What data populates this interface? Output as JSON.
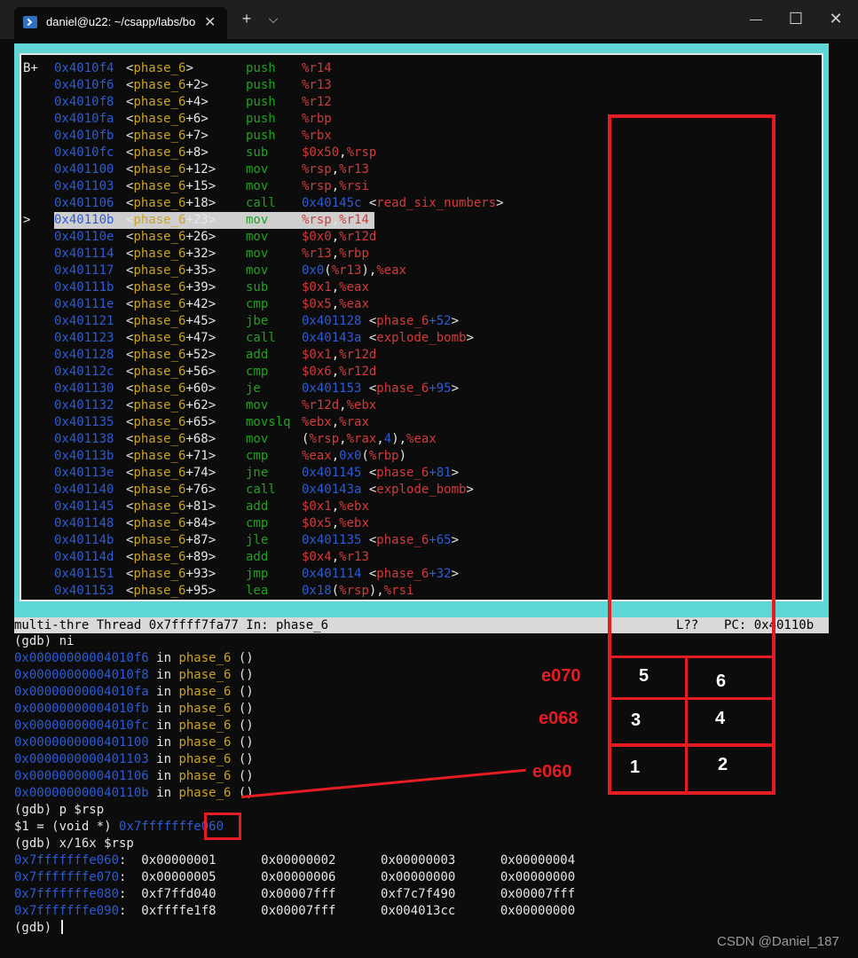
{
  "window": {
    "tab_title": "daniel@u22: ~/csapp/labs/bo",
    "tab_close": "✕",
    "new_tab": "+",
    "dropdown": "⌵",
    "minimize": "—",
    "maximize": "☐",
    "close": "✕"
  },
  "asm": [
    {
      "mark": "B+",
      "addr": "0x4010f4",
      "sym": [
        "phase_6",
        ""
      ],
      "op": "push",
      "args": [
        [
          "reg",
          "%r14"
        ]
      ]
    },
    {
      "mark": "",
      "addr": "0x4010f6",
      "sym": [
        "phase_6",
        "+2"
      ],
      "op": "push",
      "args": [
        [
          "reg",
          "%r13"
        ]
      ]
    },
    {
      "mark": "",
      "addr": "0x4010f8",
      "sym": [
        "phase_6",
        "+4"
      ],
      "op": "push",
      "args": [
        [
          "reg",
          "%r12"
        ]
      ]
    },
    {
      "mark": "",
      "addr": "0x4010fa",
      "sym": [
        "phase_6",
        "+6"
      ],
      "op": "push",
      "args": [
        [
          "reg",
          "%rbp"
        ]
      ]
    },
    {
      "mark": "",
      "addr": "0x4010fb",
      "sym": [
        "phase_6",
        "+7"
      ],
      "op": "push",
      "args": [
        [
          "reg",
          "%rbx"
        ]
      ]
    },
    {
      "mark": "",
      "addr": "0x4010fc",
      "sym": [
        "phase_6",
        "+8"
      ],
      "op": "sub",
      "args": [
        [
          "reg",
          "$0x50"
        ],
        [
          "plain",
          ","
        ],
        [
          "reg",
          "%rsp"
        ]
      ]
    },
    {
      "mark": "",
      "addr": "0x401100",
      "sym": [
        "phase_6",
        "+12"
      ],
      "op": "mov",
      "args": [
        [
          "reg",
          "%rsp"
        ],
        [
          "plain",
          ","
        ],
        [
          "reg",
          "%r13"
        ]
      ]
    },
    {
      "mark": "",
      "addr": "0x401103",
      "sym": [
        "phase_6",
        "+15"
      ],
      "op": "mov",
      "args": [
        [
          "reg",
          "%rsp"
        ],
        [
          "plain",
          ","
        ],
        [
          "reg",
          "%rsi"
        ]
      ]
    },
    {
      "mark": "",
      "addr": "0x401106",
      "sym": [
        "phase_6",
        "+18"
      ],
      "op": "call",
      "args": [
        [
          "imm",
          "0x40145c"
        ],
        [
          "plain",
          " <"
        ],
        [
          "reg",
          "read_six_numbers"
        ],
        [
          "plain",
          ">"
        ]
      ]
    },
    {
      "mark": ">",
      "addr": "0x40110b",
      "sym": [
        "phase_6",
        "+23"
      ],
      "op": "mov",
      "args": [
        [
          "reg",
          "%rsp"
        ],
        [
          "plain",
          ","
        ],
        [
          "reg",
          "%r14"
        ]
      ],
      "current": true
    },
    {
      "mark": "",
      "addr": "0x40110e",
      "sym": [
        "phase_6",
        "+26"
      ],
      "op": "mov",
      "args": [
        [
          "reg",
          "$0x0"
        ],
        [
          "plain",
          ","
        ],
        [
          "reg",
          "%r12d"
        ]
      ]
    },
    {
      "mark": "",
      "addr": "0x401114",
      "sym": [
        "phase_6",
        "+32"
      ],
      "op": "mov",
      "args": [
        [
          "reg",
          "%r13"
        ],
        [
          "plain",
          ","
        ],
        [
          "reg",
          "%rbp"
        ]
      ]
    },
    {
      "mark": "",
      "addr": "0x401117",
      "sym": [
        "phase_6",
        "+35"
      ],
      "op": "mov",
      "args": [
        [
          "imm",
          "0x0"
        ],
        [
          "plain",
          "("
        ],
        [
          "reg",
          "%r13"
        ],
        [
          "plain",
          "),"
        ],
        [
          "reg",
          "%eax"
        ]
      ]
    },
    {
      "mark": "",
      "addr": "0x40111b",
      "sym": [
        "phase_6",
        "+39"
      ],
      "op": "sub",
      "args": [
        [
          "reg",
          "$0x1"
        ],
        [
          "plain",
          ","
        ],
        [
          "reg",
          "%eax"
        ]
      ]
    },
    {
      "mark": "",
      "addr": "0x40111e",
      "sym": [
        "phase_6",
        "+42"
      ],
      "op": "cmp",
      "args": [
        [
          "reg",
          "$0x5"
        ],
        [
          "plain",
          ","
        ],
        [
          "reg",
          "%eax"
        ]
      ]
    },
    {
      "mark": "",
      "addr": "0x401121",
      "sym": [
        "phase_6",
        "+45"
      ],
      "op": "jbe",
      "args": [
        [
          "imm",
          "0x401128"
        ],
        [
          "plain",
          " <"
        ],
        [
          "reg",
          "phase_6"
        ],
        [
          "imm",
          "+52"
        ],
        [
          "plain",
          ">"
        ]
      ]
    },
    {
      "mark": "",
      "addr": "0x401123",
      "sym": [
        "phase_6",
        "+47"
      ],
      "op": "call",
      "args": [
        [
          "imm",
          "0x40143a"
        ],
        [
          "plain",
          " <"
        ],
        [
          "reg",
          "explode_bomb"
        ],
        [
          "plain",
          ">"
        ]
      ]
    },
    {
      "mark": "",
      "addr": "0x401128",
      "sym": [
        "phase_6",
        "+52"
      ],
      "op": "add",
      "args": [
        [
          "reg",
          "$0x1"
        ],
        [
          "plain",
          ","
        ],
        [
          "reg",
          "%r12d"
        ]
      ]
    },
    {
      "mark": "",
      "addr": "0x40112c",
      "sym": [
        "phase_6",
        "+56"
      ],
      "op": "cmp",
      "args": [
        [
          "reg",
          "$0x6"
        ],
        [
          "plain",
          ","
        ],
        [
          "reg",
          "%r12d"
        ]
      ]
    },
    {
      "mark": "",
      "addr": "0x401130",
      "sym": [
        "phase_6",
        "+60"
      ],
      "op": "je",
      "args": [
        [
          "imm",
          "0x401153"
        ],
        [
          "plain",
          " <"
        ],
        [
          "reg",
          "phase_6"
        ],
        [
          "imm",
          "+95"
        ],
        [
          "plain",
          ">"
        ]
      ]
    },
    {
      "mark": "",
      "addr": "0x401132",
      "sym": [
        "phase_6",
        "+62"
      ],
      "op": "mov",
      "args": [
        [
          "reg",
          "%r12d"
        ],
        [
          "plain",
          ","
        ],
        [
          "reg",
          "%ebx"
        ]
      ]
    },
    {
      "mark": "",
      "addr": "0x401135",
      "sym": [
        "phase_6",
        "+65"
      ],
      "op": "movslq",
      "args": [
        [
          "reg",
          "%ebx"
        ],
        [
          "plain",
          ","
        ],
        [
          "reg",
          "%rax"
        ]
      ]
    },
    {
      "mark": "",
      "addr": "0x401138",
      "sym": [
        "phase_6",
        "+68"
      ],
      "op": "mov",
      "args": [
        [
          "plain",
          "("
        ],
        [
          "reg",
          "%rsp"
        ],
        [
          "plain",
          ","
        ],
        [
          "reg",
          "%rax"
        ],
        [
          "plain",
          ","
        ],
        [
          "imm",
          "4"
        ],
        [
          "plain",
          "),"
        ],
        [
          "reg",
          "%eax"
        ]
      ]
    },
    {
      "mark": "",
      "addr": "0x40113b",
      "sym": [
        "phase_6",
        "+71"
      ],
      "op": "cmp",
      "args": [
        [
          "reg",
          "%eax"
        ],
        [
          "plain",
          ","
        ],
        [
          "imm",
          "0x0"
        ],
        [
          "plain",
          "("
        ],
        [
          "reg",
          "%rbp"
        ],
        [
          "plain",
          ")"
        ]
      ]
    },
    {
      "mark": "",
      "addr": "0x40113e",
      "sym": [
        "phase_6",
        "+74"
      ],
      "op": "jne",
      "args": [
        [
          "imm",
          "0x401145"
        ],
        [
          "plain",
          " <"
        ],
        [
          "reg",
          "phase_6"
        ],
        [
          "imm",
          "+81"
        ],
        [
          "plain",
          ">"
        ]
      ]
    },
    {
      "mark": "",
      "addr": "0x401140",
      "sym": [
        "phase_6",
        "+76"
      ],
      "op": "call",
      "args": [
        [
          "imm",
          "0x40143a"
        ],
        [
          "plain",
          " <"
        ],
        [
          "reg",
          "explode_bomb"
        ],
        [
          "plain",
          ">"
        ]
      ]
    },
    {
      "mark": "",
      "addr": "0x401145",
      "sym": [
        "phase_6",
        "+81"
      ],
      "op": "add",
      "args": [
        [
          "reg",
          "$0x1"
        ],
        [
          "plain",
          ","
        ],
        [
          "reg",
          "%ebx"
        ]
      ]
    },
    {
      "mark": "",
      "addr": "0x401148",
      "sym": [
        "phase_6",
        "+84"
      ],
      "op": "cmp",
      "args": [
        [
          "reg",
          "$0x5"
        ],
        [
          "plain",
          ","
        ],
        [
          "reg",
          "%ebx"
        ]
      ]
    },
    {
      "mark": "",
      "addr": "0x40114b",
      "sym": [
        "phase_6",
        "+87"
      ],
      "op": "jle",
      "args": [
        [
          "imm",
          "0x401135"
        ],
        [
          "plain",
          " <"
        ],
        [
          "reg",
          "phase_6"
        ],
        [
          "imm",
          "+65"
        ],
        [
          "plain",
          ">"
        ]
      ]
    },
    {
      "mark": "",
      "addr": "0x40114d",
      "sym": [
        "phase_6",
        "+89"
      ],
      "op": "add",
      "args": [
        [
          "reg",
          "$0x4"
        ],
        [
          "plain",
          ","
        ],
        [
          "reg",
          "%r13"
        ]
      ]
    },
    {
      "mark": "",
      "addr": "0x401151",
      "sym": [
        "phase_6",
        "+93"
      ],
      "op": "jmp",
      "args": [
        [
          "imm",
          "0x401114"
        ],
        [
          "plain",
          " <"
        ],
        [
          "reg",
          "phase_6"
        ],
        [
          "imm",
          "+32"
        ],
        [
          "plain",
          ">"
        ]
      ]
    },
    {
      "mark": "",
      "addr": "0x401153",
      "sym": [
        "phase_6",
        "+95"
      ],
      "op": "lea",
      "args": [
        [
          "imm",
          "0x18"
        ],
        [
          "plain",
          "("
        ],
        [
          "reg",
          "%rsp"
        ],
        [
          "plain",
          "),"
        ],
        [
          "reg",
          "%rsi"
        ]
      ]
    }
  ],
  "status": {
    "thread": "multi-thre Thread 0x7ffff7fa77 In: phase_6",
    "line": "L??",
    "pc": "PC: 0x40110b"
  },
  "console": [
    [
      [
        "plain",
        "(gdb) ni"
      ]
    ],
    [
      [
        "imm",
        "0x00000000004010f6"
      ],
      [
        "plain",
        " in "
      ],
      [
        "fn",
        "phase_6"
      ],
      [
        "plain",
        " ()"
      ]
    ],
    [
      [
        "imm",
        "0x00000000004010f8"
      ],
      [
        "plain",
        " in "
      ],
      [
        "fn",
        "phase_6"
      ],
      [
        "plain",
        " ()"
      ]
    ],
    [
      [
        "imm",
        "0x00000000004010fa"
      ],
      [
        "plain",
        " in "
      ],
      [
        "fn",
        "phase_6"
      ],
      [
        "plain",
        " ()"
      ]
    ],
    [
      [
        "imm",
        "0x00000000004010fb"
      ],
      [
        "plain",
        " in "
      ],
      [
        "fn",
        "phase_6"
      ],
      [
        "plain",
        " ()"
      ]
    ],
    [
      [
        "imm",
        "0x00000000004010fc"
      ],
      [
        "plain",
        " in "
      ],
      [
        "fn",
        "phase_6"
      ],
      [
        "plain",
        " ()"
      ]
    ],
    [
      [
        "imm",
        "0x0000000000401100"
      ],
      [
        "plain",
        " in "
      ],
      [
        "fn",
        "phase_6"
      ],
      [
        "plain",
        " ()"
      ]
    ],
    [
      [
        "imm",
        "0x0000000000401103"
      ],
      [
        "plain",
        " in "
      ],
      [
        "fn",
        "phase_6"
      ],
      [
        "plain",
        " ()"
      ]
    ],
    [
      [
        "imm",
        "0x0000000000401106"
      ],
      [
        "plain",
        " in "
      ],
      [
        "fn",
        "phase_6"
      ],
      [
        "plain",
        " ()"
      ]
    ],
    [
      [
        "imm",
        "0x000000000040110b"
      ],
      [
        "plain",
        " in "
      ],
      [
        "fn",
        "phase_6"
      ],
      [
        "plain",
        " ()"
      ]
    ],
    [
      [
        "plain",
        "(gdb) p $rsp"
      ]
    ],
    [
      [
        "plain",
        "$1 = (void *) "
      ],
      [
        "imm",
        "0x7fffffffe060"
      ]
    ],
    [
      [
        "plain",
        "(gdb) x/16x $rsp"
      ]
    ],
    [
      [
        "imm",
        "0x7fffffffe060"
      ],
      [
        "plain",
        ":  0x00000001      0x00000002      0x00000003      0x00000004"
      ]
    ],
    [
      [
        "imm",
        "0x7fffffffe070"
      ],
      [
        "plain",
        ":  0x00000005      0x00000006      0x00000000      0x00000000"
      ]
    ],
    [
      [
        "imm",
        "0x7fffffffe080"
      ],
      [
        "plain",
        ":  0xf7ffd040      0x00007fff      0xf7c7f490      0x00007fff"
      ]
    ],
    [
      [
        "imm",
        "0x7fffffffe090"
      ],
      [
        "plain",
        ":  0xffffe1f8      0x00007fff      0x004013cc      0x00000000"
      ]
    ],
    [
      [
        "plain",
        "(gdb) "
      ]
    ]
  ],
  "annotations": {
    "labels": [
      "e070",
      "e068",
      "e060"
    ],
    "cells": [
      "5",
      "6",
      "3",
      "4",
      "1",
      "2"
    ]
  },
  "watermark": "CSDN @Daniel_187",
  "colors": {
    "tui_border": "#5fd7d7",
    "annotation_red": "#e51c23",
    "address_blue": "#2d5bd6",
    "register_red": "#d43a3a",
    "opcode_green": "#1fa31f",
    "symbol_gold": "#c9a227"
  }
}
